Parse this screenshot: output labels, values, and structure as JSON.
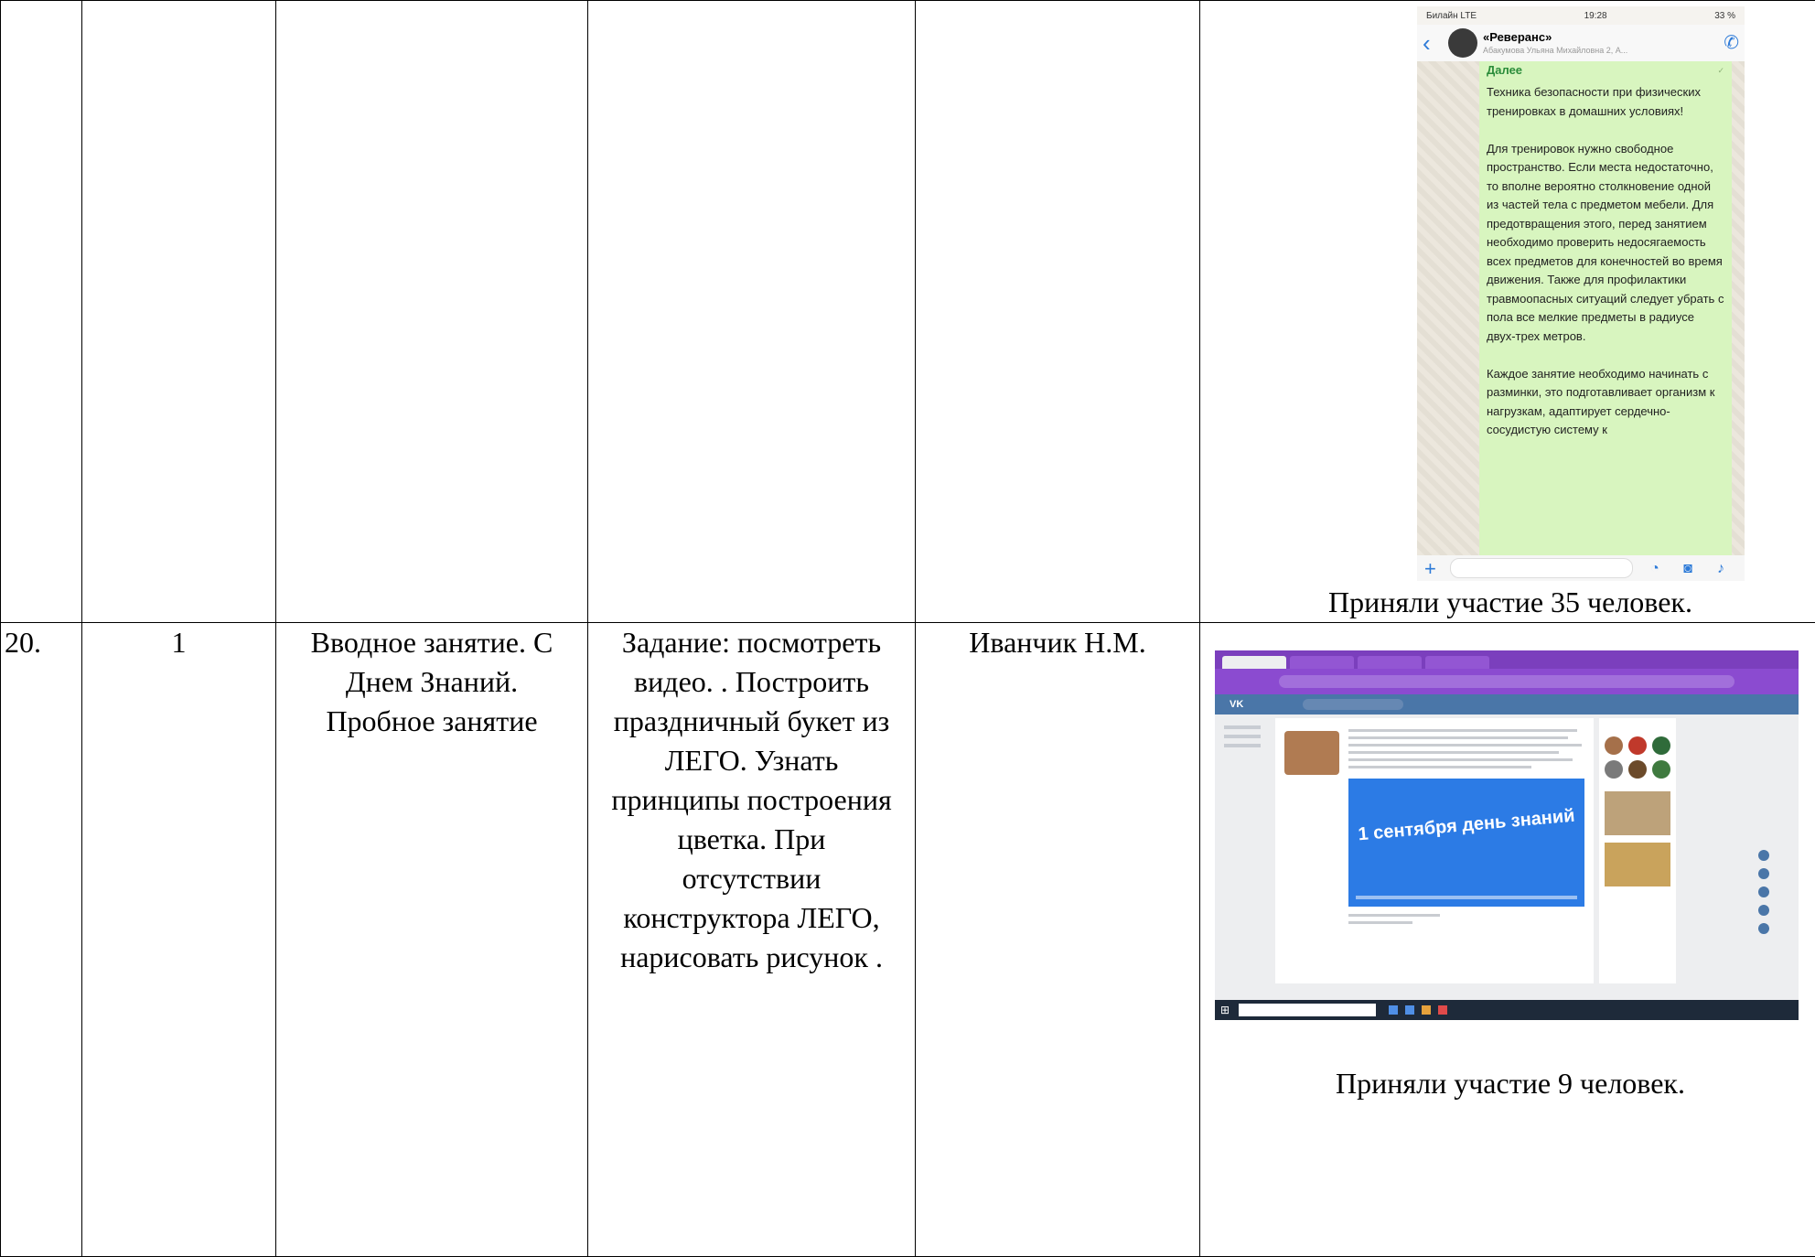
{
  "rows": [
    {
      "num": "",
      "qty": "",
      "topic": "",
      "task": "",
      "teacher": "",
      "screenshot": "phone",
      "caption": "Приняли участие 35 человек."
    },
    {
      "num": "20.",
      "qty": "1",
      "topic": "Вводное занятие. С Днем Знаний. Пробное занятие",
      "task": "Задание: посмотреть видео. .  Построить праздничный букет из ЛЕГО. Узнать принципы построения цветка. При отсутствии конструктора ЛЕГО, нарисовать рисунок .",
      "teacher": "Иванчик Н.М.",
      "screenshot": "desktop",
      "caption": "Приняли участие 9 человек."
    }
  ],
  "phone": {
    "carrier": "Билайн  LTE",
    "time": "19:28",
    "battery": "33 %",
    "chat_name": "«Реверанс»",
    "chat_members": "Абакумова Ульяна Михайловна 2, А...",
    "forwarded_label": "Далее",
    "message": "Техника безопасности при физических тренировках в домашних условиях!\n\nДля тренировок нужно свободное пространство. Если места недостаточно, то вполне вероятно столкновение одной из частей тела с предметом мебели. Для предотвращения этого, перед занятием необходимо проверить недосягаемость всех предметов для конечностей во время движения. Также для профилактики травмоопасных ситуаций следует убрать с пола все мелкие предметы в радиусе двух-трех метров.\n\nКаждое занятие необходимо начинать с разминки, это подготавливает организм к нагрузкам, адаптирует сердечно-сосудистую систему к"
  },
  "desktop": {
    "video_text": "1 сентября день знаний"
  }
}
